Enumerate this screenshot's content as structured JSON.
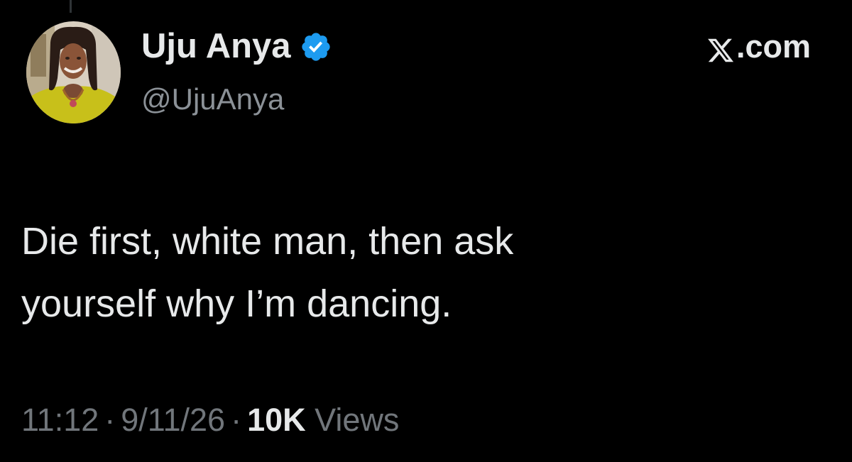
{
  "tweet": {
    "author": {
      "display_name": "Uju Anya",
      "handle": "@UjuAnya",
      "verified": true,
      "avatar": "profile-photo"
    },
    "brand": {
      "icon": "x-logo-icon",
      "text": ".com"
    },
    "text_lines": [
      "Die first, white man, then ask",
      "yourself why I’m dancing."
    ],
    "meta": {
      "time": "11:12",
      "separator": "·",
      "date": "9/11/26",
      "views_count": "10K",
      "views_label": "Views"
    }
  },
  "colors": {
    "background": "#000000",
    "text_primary": "#e7e9ea",
    "text_secondary": "#71767b",
    "verified_badge": "#1d9bf0"
  }
}
